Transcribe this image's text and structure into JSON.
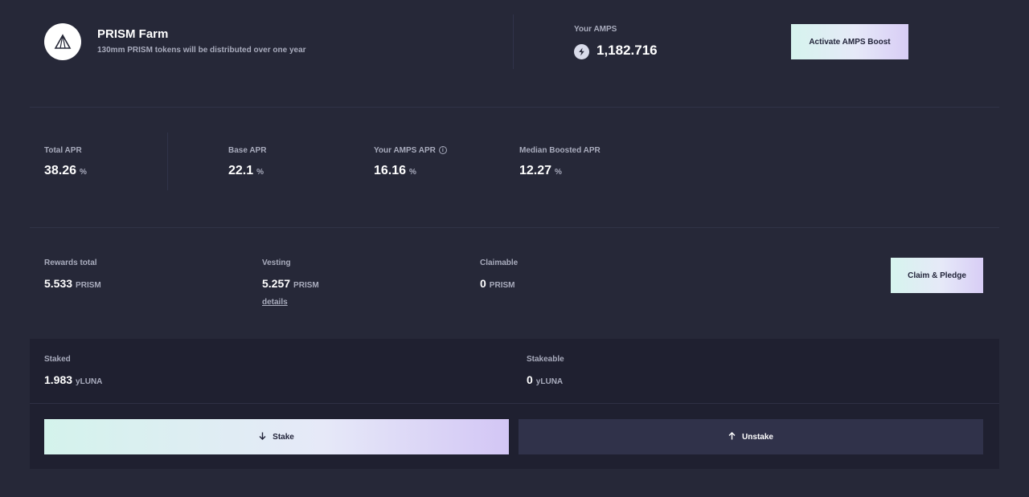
{
  "header": {
    "title": "PRISM Farm",
    "subtitle": "130mm PRISM tokens will be distributed over one year",
    "amps_label": "Your AMPS",
    "amps_value": "1,182.716",
    "activate_button": "Activate AMPS Boost"
  },
  "apr": {
    "total": {
      "label": "Total APR",
      "value": "38.26",
      "unit": "%"
    },
    "base": {
      "label": "Base APR",
      "value": "22.1",
      "unit": "%"
    },
    "amps": {
      "label": "Your AMPS APR",
      "value": "16.16",
      "unit": "%"
    },
    "median": {
      "label": "Median Boosted APR",
      "value": "12.27",
      "unit": "%"
    }
  },
  "rewards": {
    "total": {
      "label": "Rewards total",
      "value": "5.533",
      "unit": "PRISM"
    },
    "vesting": {
      "label": "Vesting",
      "value": "5.257",
      "unit": "PRISM",
      "link": "details"
    },
    "claimable": {
      "label": "Claimable",
      "value": "0",
      "unit": "PRISM"
    },
    "claim_button": "Claim & Pledge"
  },
  "staking": {
    "staked": {
      "label": "Staked",
      "value": "1.983",
      "unit": "yLUNA"
    },
    "stakeable": {
      "label": "Stakeable",
      "value": "0",
      "unit": "yLUNA"
    },
    "stake_button": "Stake",
    "unstake_button": "Unstake"
  },
  "icons": {
    "logo": "prism-logo-icon",
    "amps": "lightning-icon",
    "info": "info-icon",
    "stake": "arrow-down-icon",
    "unstake": "arrow-up-icon"
  },
  "colors": {
    "background": "#262838",
    "panel": "#1f2030",
    "muted_text": "#a9acbd",
    "button_gradient_start": "#d4f3ec",
    "button_gradient_end": "#d3c6f5",
    "unstake_button": "#30324a"
  }
}
